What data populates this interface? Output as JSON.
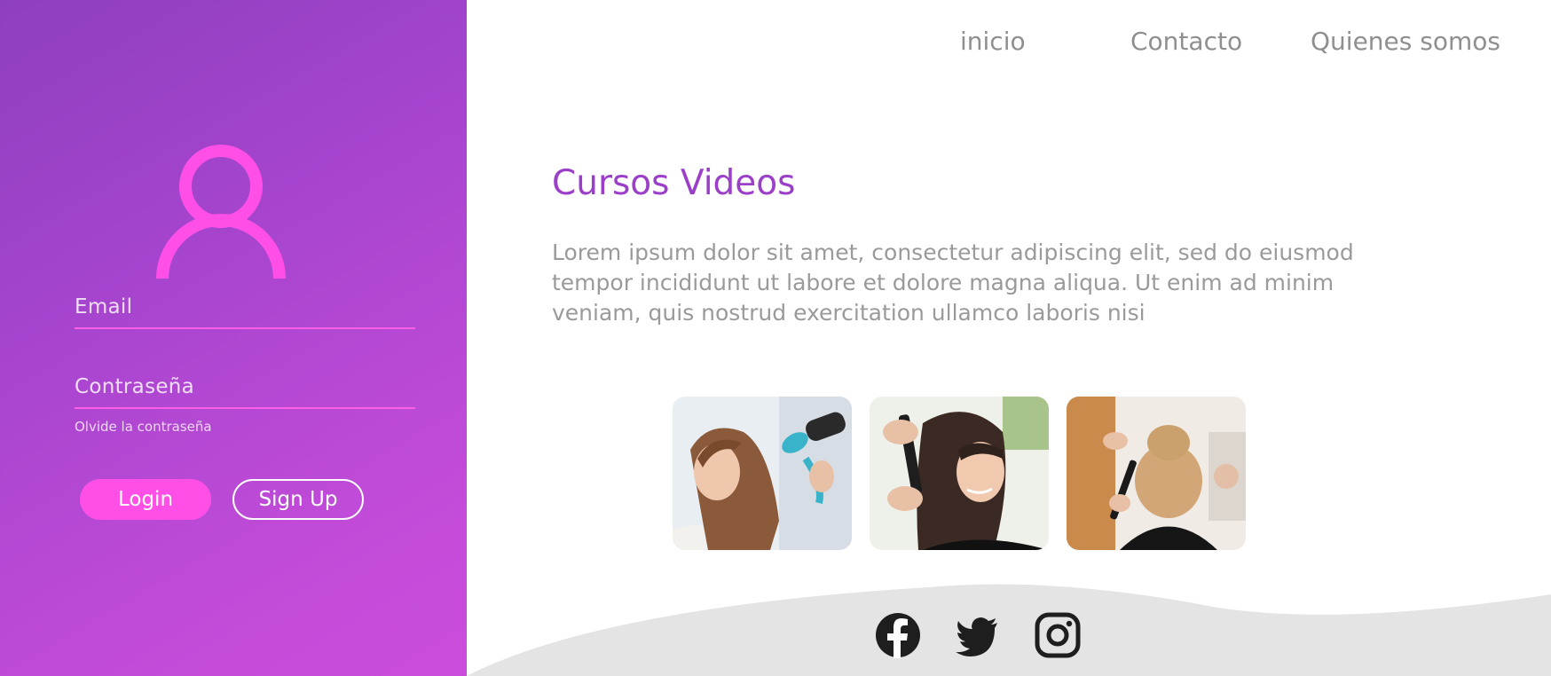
{
  "nav": {
    "items": [
      {
        "label": "inicio"
      },
      {
        "label": "Contacto"
      },
      {
        "label": "Quienes somos"
      }
    ]
  },
  "login": {
    "email_label": "Email",
    "password_label": "Contraseña",
    "forgot_label": "Olvide la contraseña",
    "login_button": "Login",
    "signup_button": "Sign Up"
  },
  "main": {
    "title": "Cursos Videos",
    "description": "Lorem ipsum dolor sit amet, consectetur adipiscing elit, sed do eiusmod tempor incididunt ut labore et dolore magna aliqua. Ut enim ad minim veniam, quis nostrud exercitation ullamco laboris nisi",
    "images": [
      {
        "icon": "hair-drying-photo"
      },
      {
        "icon": "hair-straightening-photo"
      },
      {
        "icon": "hair-updo-photo"
      }
    ]
  },
  "footer": {
    "social": [
      {
        "icon": "facebook-icon"
      },
      {
        "icon": "twitter-icon"
      },
      {
        "icon": "instagram-icon"
      }
    ]
  },
  "colors": {
    "panel_gradient_start": "#8e3fbf",
    "panel_gradient_end": "#cb4ddb",
    "accent_pink": "#ff4fe6",
    "title_purple": "#9b3fc9",
    "text_gray": "#9a9a9a",
    "footer_gray": "#e4e4e4"
  }
}
